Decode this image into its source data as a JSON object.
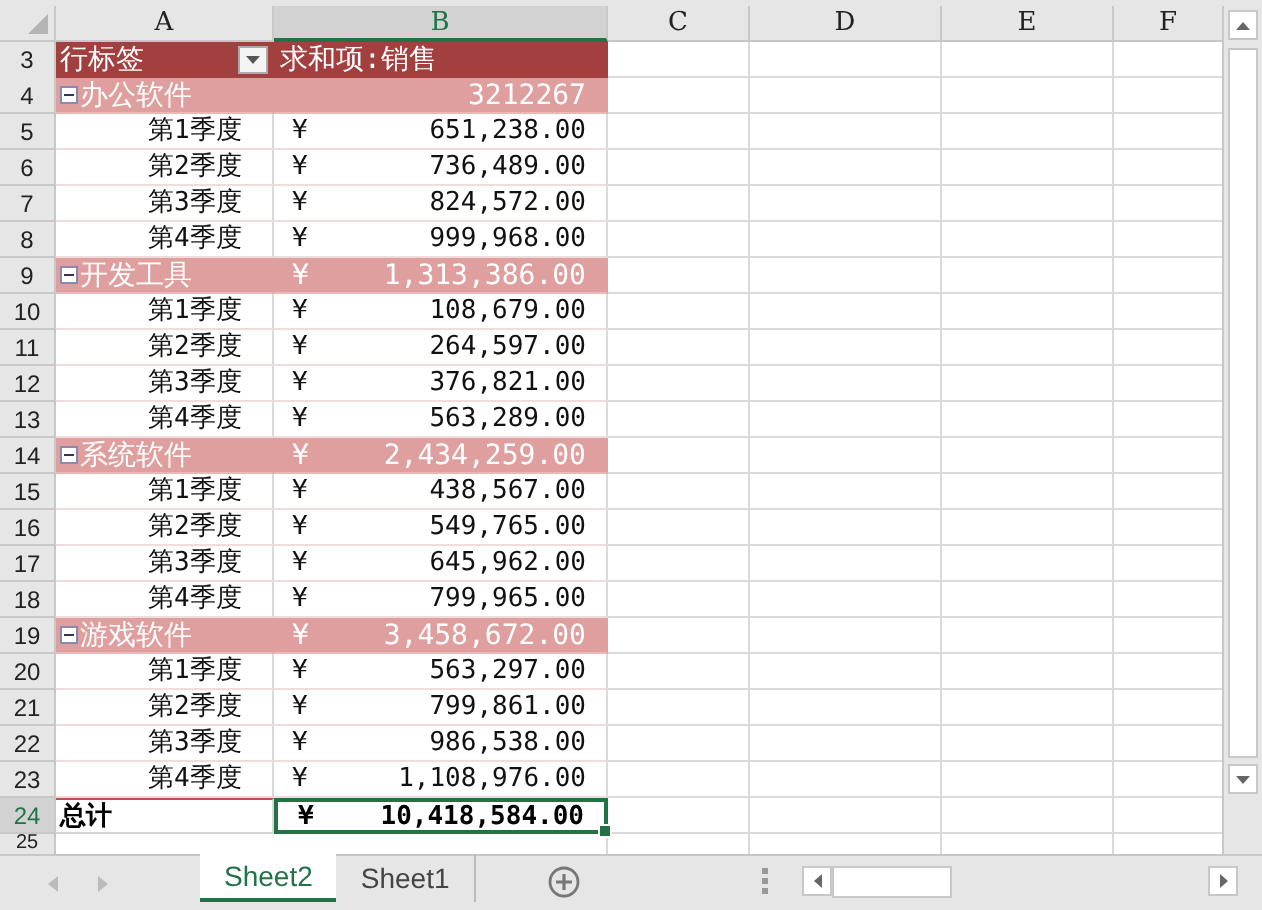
{
  "columns": [
    {
      "letter": "A",
      "selected": false
    },
    {
      "letter": "B",
      "selected": true
    },
    {
      "letter": "C",
      "selected": false
    },
    {
      "letter": "D",
      "selected": false
    },
    {
      "letter": "E",
      "selected": false
    },
    {
      "letter": "F",
      "selected": false
    }
  ],
  "rows": [
    {
      "number": "3",
      "kind": "header",
      "label": "行标签",
      "value_label": "求和项:销售"
    },
    {
      "number": "4",
      "kind": "group",
      "expanded": true,
      "label": "办公软件",
      "amount": "3212267"
    },
    {
      "number": "5",
      "kind": "item",
      "label": "第1季度",
      "currency": "¥",
      "amount": "651,238.00"
    },
    {
      "number": "6",
      "kind": "item",
      "label": "第2季度",
      "currency": "¥",
      "amount": "736,489.00"
    },
    {
      "number": "7",
      "kind": "item",
      "label": "第3季度",
      "currency": "¥",
      "amount": "824,572.00"
    },
    {
      "number": "8",
      "kind": "item",
      "label": "第4季度",
      "currency": "¥",
      "amount": "999,968.00"
    },
    {
      "number": "9",
      "kind": "group",
      "expanded": true,
      "label": "开发工具",
      "currency": "¥",
      "amount": "1,313,386.00"
    },
    {
      "number": "10",
      "kind": "item",
      "label": "第1季度",
      "currency": "¥",
      "amount": "108,679.00"
    },
    {
      "number": "11",
      "kind": "item",
      "label": "第2季度",
      "currency": "¥",
      "amount": "264,597.00"
    },
    {
      "number": "12",
      "kind": "item",
      "label": "第3季度",
      "currency": "¥",
      "amount": "376,821.00"
    },
    {
      "number": "13",
      "kind": "item",
      "label": "第4季度",
      "currency": "¥",
      "amount": "563,289.00"
    },
    {
      "number": "14",
      "kind": "group",
      "expanded": true,
      "label": "系统软件",
      "currency": "¥",
      "amount": "2,434,259.00"
    },
    {
      "number": "15",
      "kind": "item",
      "label": "第1季度",
      "currency": "¥",
      "amount": "438,567.00"
    },
    {
      "number": "16",
      "kind": "item",
      "label": "第2季度",
      "currency": "¥",
      "amount": "549,765.00"
    },
    {
      "number": "17",
      "kind": "item",
      "label": "第3季度",
      "currency": "¥",
      "amount": "645,962.00"
    },
    {
      "number": "18",
      "kind": "item",
      "label": "第4季度",
      "currency": "¥",
      "amount": "799,965.00"
    },
    {
      "number": "19",
      "kind": "group",
      "expanded": true,
      "label": "游戏软件",
      "currency": "¥",
      "amount": "3,458,672.00"
    },
    {
      "number": "20",
      "kind": "item",
      "label": "第1季度",
      "currency": "¥",
      "amount": "563,297.00"
    },
    {
      "number": "21",
      "kind": "item",
      "label": "第2季度",
      "currency": "¥",
      "amount": "799,861.00"
    },
    {
      "number": "22",
      "kind": "item",
      "label": "第3季度",
      "currency": "¥",
      "amount": "986,538.00"
    },
    {
      "number": "23",
      "kind": "item",
      "label": "第4季度",
      "currency": "¥",
      "amount": "1,108,976.00"
    },
    {
      "number": "24",
      "kind": "total",
      "selected": true,
      "label": "总计",
      "currency": "¥",
      "amount": "10,418,584.00"
    },
    {
      "number": "25",
      "kind": "blank"
    }
  ],
  "sheet_tabs": [
    {
      "label": "Sheet2",
      "selected": true
    },
    {
      "label": "Sheet1",
      "selected": false
    }
  ]
}
